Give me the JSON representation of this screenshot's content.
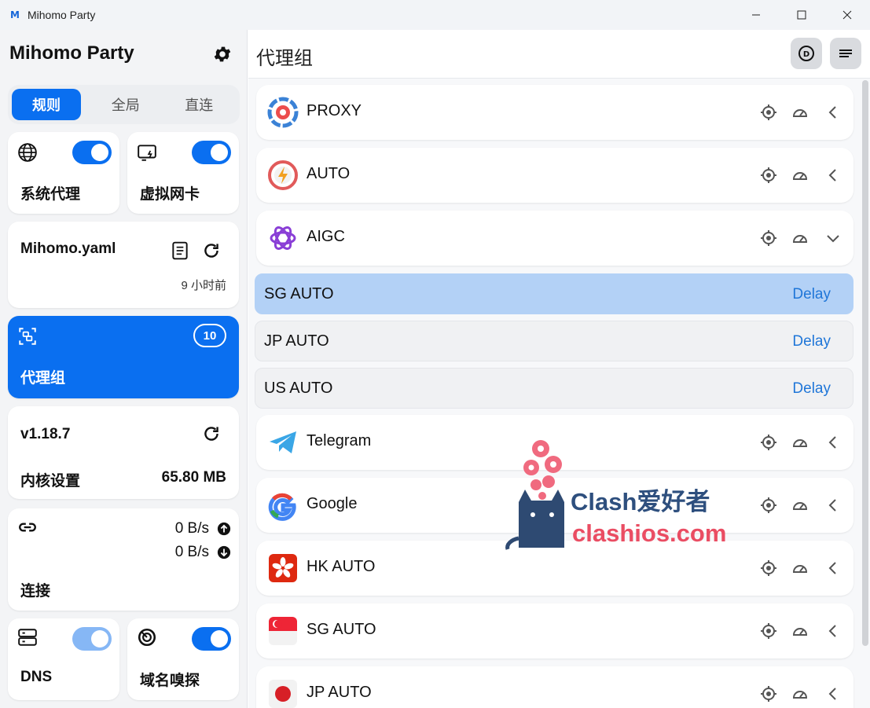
{
  "window": {
    "title": "Mihomo Party",
    "logo_letter": "M"
  },
  "sidebar": {
    "app_title": "Mihomo Party",
    "mode_tabs": [
      "规则",
      "全局",
      "直连"
    ],
    "cards": {
      "system_proxy": {
        "label": "系统代理",
        "enabled": true
      },
      "tun": {
        "label": "虚拟网卡",
        "enabled": true
      },
      "profile": {
        "name": "Mihomo.yaml",
        "updated": "9 小时前"
      },
      "proxies": {
        "label": "代理组",
        "count": "10"
      },
      "core": {
        "version": "v1.18.7",
        "label": "内核设置",
        "memory": "65.80 MB"
      },
      "connections": {
        "upload": "0 B/s",
        "download": "0 B/s",
        "label": "连接"
      },
      "dns": {
        "label": "DNS",
        "enabled": true
      },
      "sniff": {
        "label": "域名嗅探",
        "enabled": true
      }
    }
  },
  "main": {
    "title": "代理组",
    "groups": [
      {
        "name": "PROXY",
        "icon": "proxy-ring-icon"
      },
      {
        "name": "AUTO",
        "icon": "lightning-icon"
      },
      {
        "name": "AIGC",
        "icon": "openai-icon",
        "expanded": true
      },
      {
        "name": "Telegram",
        "icon": "telegram-icon"
      },
      {
        "name": "Google",
        "icon": "google-icon"
      },
      {
        "name": "HK AUTO",
        "icon": "hk-flag-icon"
      },
      {
        "name": "SG AUTO",
        "icon": "sg-flag-icon"
      },
      {
        "name": "JP AUTO",
        "icon": "jp-flag-icon"
      }
    ],
    "sub_items": [
      {
        "name": "SG AUTO",
        "delay": "Delay",
        "selected": true
      },
      {
        "name": "JP AUTO",
        "delay": "Delay",
        "selected": false
      },
      {
        "name": "US AUTO",
        "delay": "Delay",
        "selected": false
      }
    ]
  },
  "watermark": {
    "line1": "Clash爱好者",
    "line2": "clashios.com"
  },
  "colors": {
    "accent": "#0a6ff0",
    "selected_row": "#b3d1f6",
    "delay_text": "#1f76d8"
  }
}
